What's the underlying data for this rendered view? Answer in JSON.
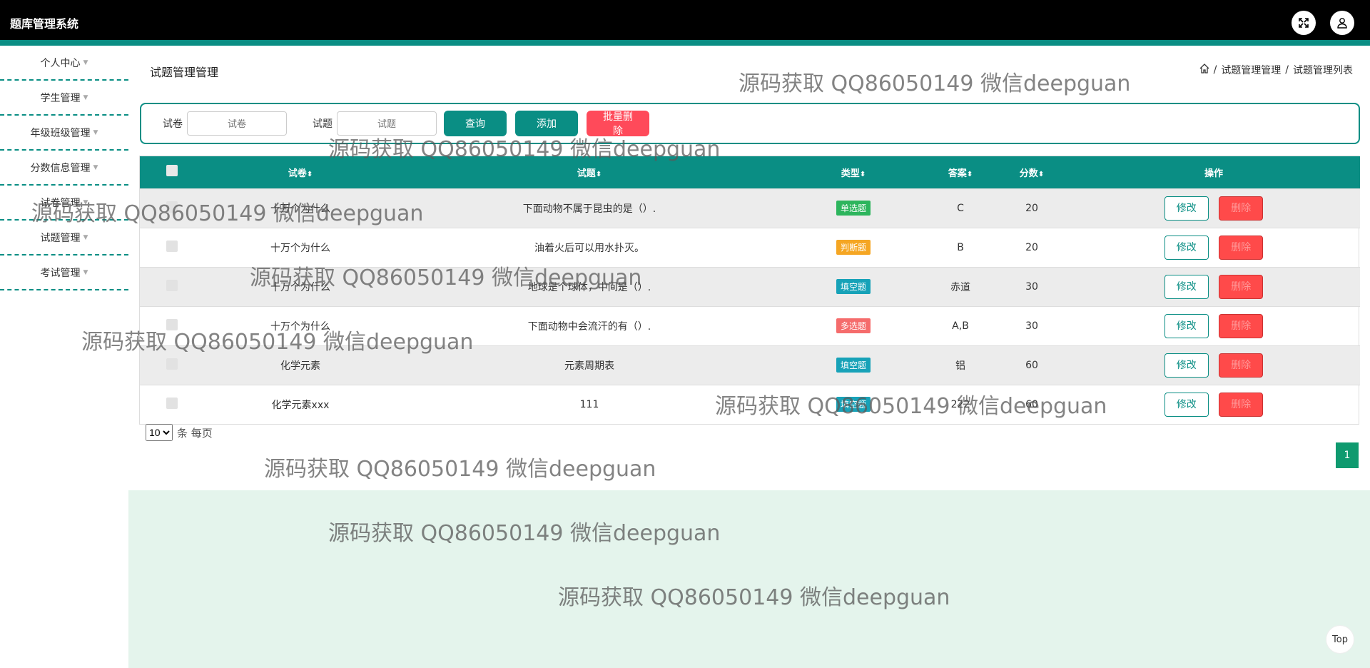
{
  "app": {
    "title": "题库管理系统"
  },
  "header": {
    "fullscreen_icon": "fullscreen-icon",
    "user_icon": "user-icon"
  },
  "sidebar": {
    "items": [
      {
        "label": "个人中心"
      },
      {
        "label": "学生管理"
      },
      {
        "label": "年级班级管理"
      },
      {
        "label": "分数信息管理"
      },
      {
        "label": "试卷管理"
      },
      {
        "label": "试题管理"
      },
      {
        "label": "考试管理"
      }
    ]
  },
  "main": {
    "title": "试题管理管理",
    "breadcrumb": [
      "试题管理管理",
      "试题管理列表"
    ]
  },
  "search": {
    "paper_label": "试卷",
    "paper_placeholder": "试卷",
    "question_label": "试题",
    "question_placeholder": "试题",
    "query_btn": "查询",
    "add_btn": "添加",
    "batch_delete_btn": "批量删除"
  },
  "table": {
    "headers": {
      "paper": "试卷",
      "question": "试题",
      "type": "类型",
      "answer": "答案",
      "score": "分数",
      "action": "操作"
    },
    "edit_label": "修改",
    "delete_label": "删除",
    "rows": [
      {
        "paper": "十万个为什么",
        "question": "下面动物不属于昆虫的是（）.",
        "type": "单选题",
        "type_color": "#2db55d",
        "answer": "C",
        "score": "20"
      },
      {
        "paper": "十万个为什么",
        "question": "油着火后可以用水扑灭。",
        "type": "判断题",
        "type_color": "#f5a623",
        "answer": "B",
        "score": "20"
      },
      {
        "paper": "十万个为什么",
        "question": "地球是个球体，中间是（）.",
        "type": "填空题",
        "type_color": "#17a2b8",
        "answer": "赤道",
        "score": "30"
      },
      {
        "paper": "十万个为什么",
        "question": "下面动物中会流汗的有（）.",
        "type": "多选题",
        "type_color": "#f56c6c",
        "answer": "A,B",
        "score": "30"
      },
      {
        "paper": "化学元素",
        "question": "元素周期表",
        "type": "填空题",
        "type_color": "#17a2b8",
        "answer": "铝",
        "score": "60"
      },
      {
        "paper": "化学元素xxx",
        "question": "111",
        "type": "填空题",
        "type_color": "#17a2b8",
        "answer": "222",
        "score": "60"
      }
    ]
  },
  "pager": {
    "page_size": "10",
    "per_page_label": "条 每页",
    "current_page": "1"
  },
  "back_to_top": "Top",
  "watermark": "源码获取 QQ86050149 微信deepguan"
}
